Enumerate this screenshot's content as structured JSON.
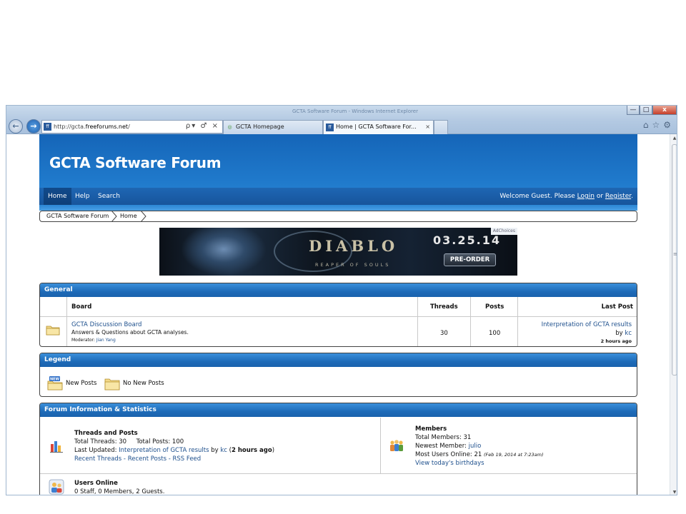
{
  "browser": {
    "window_title": "GCTA Software Forum - Windows Internet Explorer",
    "address_url_prefix": "http://gcta.",
    "address_url_domain": "freeforums.net",
    "address_url_suffix": "/",
    "address_controls": "ρ▾ ♂ ×",
    "tabs": [
      {
        "label": "GCTA Homepage"
      },
      {
        "label": "Home | GCTA Software For..."
      }
    ],
    "tab_close": "×",
    "tools": "⌂☆⚙",
    "caption": {
      "min": "—",
      "max": "□",
      "close": "x"
    }
  },
  "forum": {
    "title": "GCTA Software Forum",
    "nav": [
      {
        "label": "Home"
      },
      {
        "label": "Help"
      },
      {
        "label": "Search"
      }
    ],
    "welcome_prefix": "Welcome Guest. Please ",
    "login_label": "Login",
    "welcome_mid": " or ",
    "register_label": "Register",
    "welcome_suffix": "."
  },
  "breadcrumb": [
    {
      "label": "GCTA Software Forum"
    },
    {
      "label": "Home"
    }
  ],
  "ad": {
    "adchoices": "AdChoices",
    "game_title": "DIABLO",
    "subtitle": "REAPER OF SOULS",
    "date": "03.25.14",
    "cta": "PRE-ORDER"
  },
  "general": {
    "heading": "General",
    "columns": {
      "board": "Board",
      "threads": "Threads",
      "posts": "Posts",
      "last_post": "Last Post"
    },
    "board": {
      "name": "GCTA Discussion Board",
      "description": "Answers & Questions about GCTA analyses.",
      "moderator_label": "Moderator: ",
      "moderator": "Jian Yang",
      "threads": "30",
      "posts": "100",
      "last_post_title": "Interpretation of GCTA results",
      "last_post_by_label": "by ",
      "last_post_by": "kc",
      "last_post_time": "2 hours ago"
    }
  },
  "legend": {
    "heading": "Legend",
    "new_posts": "New Posts",
    "no_new_posts": "No New Posts",
    "new_badge": "NEW"
  },
  "info": {
    "heading": "Forum Information & Statistics",
    "threads_posts": {
      "title": "Threads and Posts",
      "totals": "Total Threads: 30     Total Posts: 100",
      "last_updated_label": "Last Updated: ",
      "last_updated_link": "Interpretation of GCTA results",
      "by_label": " by ",
      "by_user": "kc",
      "time_open": " (",
      "time": "2 hours ago",
      "time_close": ")",
      "recent_threads": "Recent Threads",
      "sep": " - ",
      "recent_posts": "Recent Posts",
      "rss": "RSS Feed"
    },
    "members": {
      "title": "Members",
      "total": "Total Members: 31",
      "newest_label": "Newest Member: ",
      "newest": "julio",
      "most_online_label": "Most Users Online: 21 ",
      "most_online_date": "(Feb 19, 2014 at 7:23am)",
      "birthdays": "View today's birthdays"
    },
    "online": {
      "title": "Users Online",
      "summary": "0 Staff, 0 Members, 2 Guests."
    }
  },
  "colors": {
    "header_blue": "#1f79cb",
    "link_blue": "#1d4f8c",
    "panel_head": "#1e6bb8"
  }
}
